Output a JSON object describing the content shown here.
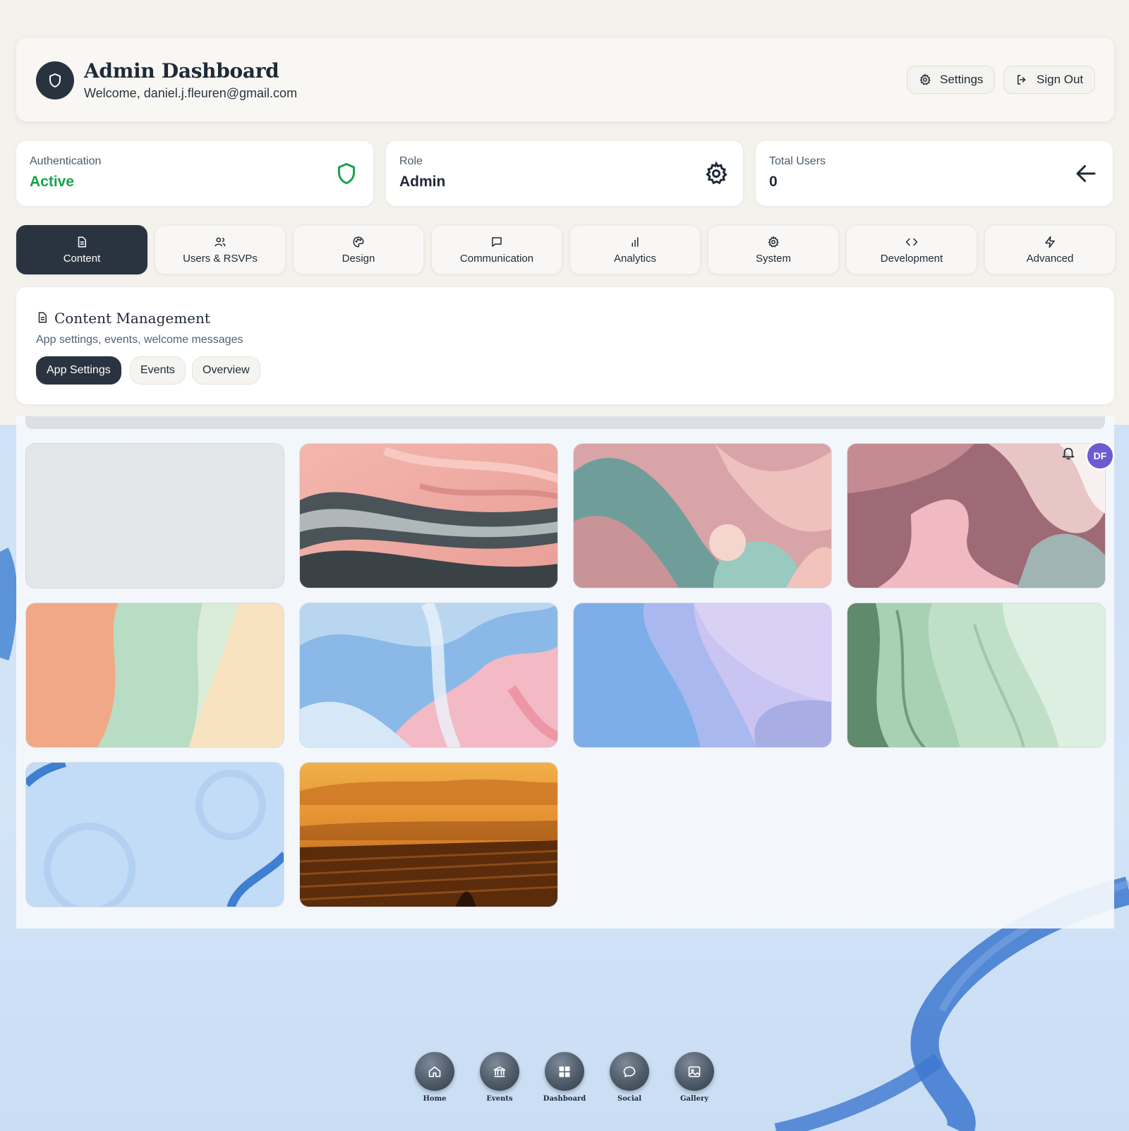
{
  "header": {
    "title": "Admin Dashboard",
    "welcome": "Welcome, daniel.j.fleuren@gmail.com",
    "settings_label": "Settings",
    "signout_label": "Sign Out"
  },
  "stats": [
    {
      "label": "Authentication",
      "value": "Active",
      "icon": "shield-icon"
    },
    {
      "label": "Role",
      "value": "Admin",
      "icon": "gear-icon"
    },
    {
      "label": "Total Users",
      "value": "0",
      "icon": "arrow-left-icon"
    }
  ],
  "tabs": [
    {
      "label": "Content",
      "icon": "document-icon",
      "active": true
    },
    {
      "label": "Users & RSVPs",
      "icon": "users-icon"
    },
    {
      "label": "Design",
      "icon": "palette-icon"
    },
    {
      "label": "Communication",
      "icon": "chat-icon"
    },
    {
      "label": "Analytics",
      "icon": "bar-chart-icon"
    },
    {
      "label": "System",
      "icon": "gear-icon"
    },
    {
      "label": "Development",
      "icon": "code-icon"
    },
    {
      "label": "Advanced",
      "icon": "lightning-icon"
    }
  ],
  "content_management": {
    "title": "Content Management",
    "subtitle": "App settings, events, welcome messages",
    "subtabs": [
      {
        "label": "App Settings",
        "active": true
      },
      {
        "label": "Events"
      },
      {
        "label": "Overview"
      }
    ]
  },
  "gallery": {
    "tiles": [
      {
        "name": "placeholder-tile"
      },
      {
        "name": "pink-silver-waves-tile"
      },
      {
        "name": "teal-pink-hills-tile"
      },
      {
        "name": "mauve-pink-folds-tile"
      },
      {
        "name": "peach-mint-waves-tile"
      },
      {
        "name": "blue-pink-silk-tile"
      },
      {
        "name": "blue-lavender-waves-tile"
      },
      {
        "name": "green-layers-tile"
      },
      {
        "name": "light-blue-ribbon-tile"
      },
      {
        "name": "golden-vineyard-tile"
      }
    ]
  },
  "user": {
    "initials": "DF"
  },
  "bottom_nav": [
    {
      "label": "Home",
      "icon": "home-icon"
    },
    {
      "label": "Events",
      "icon": "bank-icon"
    },
    {
      "label": "Dashboard",
      "icon": "grid-icon"
    },
    {
      "label": "Social",
      "icon": "chat-icon"
    },
    {
      "label": "Gallery",
      "icon": "image-icon"
    }
  ],
  "colors": {
    "primary_dark": "#2a3441",
    "success": "#16a34a",
    "avatar": "#6d5bd0"
  }
}
